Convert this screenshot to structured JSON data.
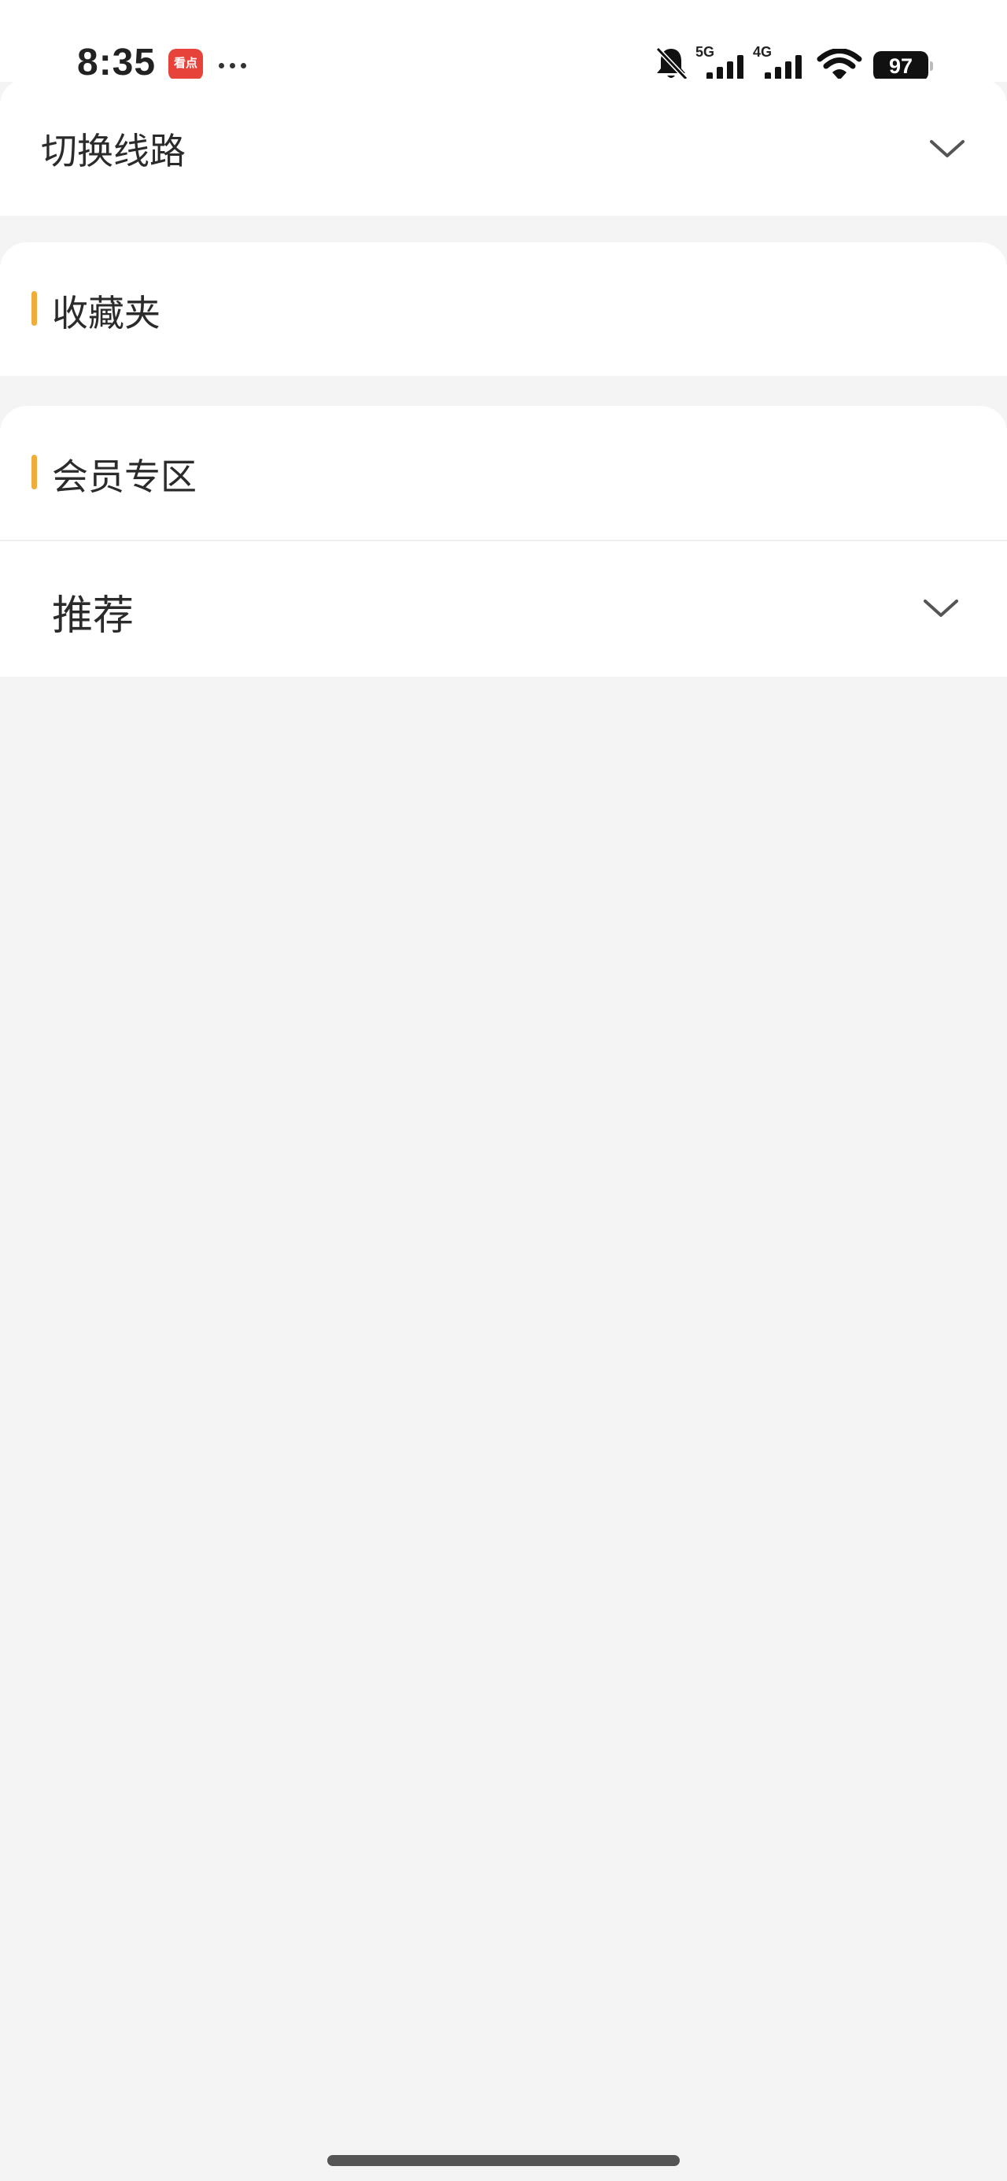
{
  "status_bar": {
    "time": "8:35",
    "app_icon_label": "看点",
    "signal_1_label": "5G",
    "signal_2_label": "4G",
    "battery": "97",
    "icons": [
      "bell-muted-icon",
      "signal-icon",
      "signal-icon",
      "wifi-icon",
      "battery-icon"
    ]
  },
  "switch_route": {
    "title": "切换线路",
    "icon": "chevron-down-icon"
  },
  "favorites": {
    "title": "收藏夹"
  },
  "member_zone": {
    "title": "会员专区",
    "dropdown": {
      "selected": "推荐",
      "icon": "chevron-down-icon"
    }
  },
  "colors": {
    "accent": "#f0ad3c",
    "background": "#f4f4f4",
    "card": "#ffffff",
    "text": "#2b2b2b"
  }
}
